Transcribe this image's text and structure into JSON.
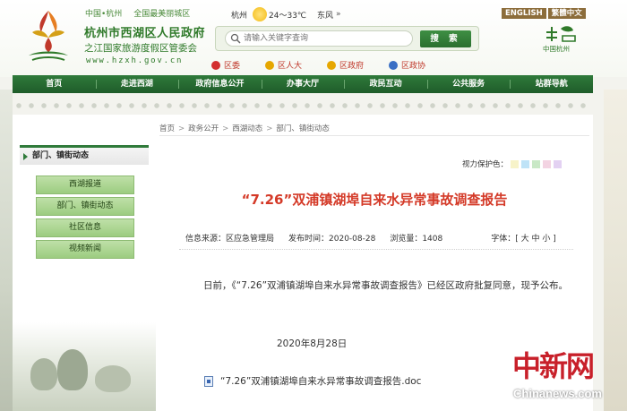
{
  "header": {
    "top_tags": [
      "中国•杭州",
      "全国最美丽城区"
    ],
    "title": "杭州市西湖区人民政府",
    "subtitle": "之江国家旅游度假区管委会",
    "url": "www.hzxh.gov.cn",
    "weather": {
      "city": "杭州",
      "temp": "24～33℃",
      "wind": "东风",
      "more": "»"
    },
    "search": {
      "placeholder": "请输入关键字查询",
      "button": "搜 索"
    },
    "party_links": [
      "区委",
      "区人大",
      "区政府",
      "区政协"
    ],
    "lang": [
      "ENGLISH",
      "繁體中文"
    ],
    "city_logo_label": "中国杭州"
  },
  "nav": [
    "首页",
    "走进西湖",
    "政府信息公开",
    "办事大厅",
    "政民互动",
    "公共服务",
    "站群导航"
  ],
  "sidebar": {
    "header": "部门、镇街动态",
    "items": [
      "西湖报道",
      "部门、镇街动态",
      "社区信息",
      "视频新闻"
    ]
  },
  "breadcrumb": [
    "首页",
    "政务公开",
    "西湖动态",
    "部门、镇街动态"
  ],
  "guard": {
    "label": "视力保护色：",
    "colors": [
      "#f7f3c9",
      "#bfe3f7",
      "#c9e8c6",
      "#f3d3e2",
      "#e3d1f2"
    ]
  },
  "article": {
    "title": "“7.26”双浦镇湖埠自来水异常事故调查报告",
    "source": "信息来源：区应急管理局",
    "published": "发布时间：2020-08-28",
    "views": "浏览量：1408",
    "font_size": "字体：[ 大 中 小 ]",
    "body": "日前，《“7.26”双浦镇湖埠自来水异常事故调查报告》已经区政府批复同意，现予公布。",
    "date": "2020年8月28日",
    "attachment": "“7.26”双浦镇湖埠自来水异常事故调查报告.doc"
  },
  "watermark": {
    "logo": "中新网",
    "site": "Chinanews.com"
  }
}
